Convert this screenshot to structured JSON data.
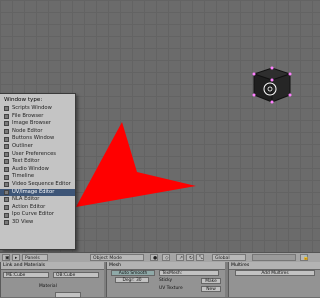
{
  "menu": {
    "title": "Window type:",
    "items": [
      {
        "label": "Scripts Window",
        "selected": false
      },
      {
        "label": "File Browser",
        "selected": false
      },
      {
        "label": "Image Browser",
        "selected": false
      },
      {
        "label": "Node Editor",
        "selected": false
      },
      {
        "label": "Buttons Window",
        "selected": false
      },
      {
        "label": "Outliner",
        "selected": false
      },
      {
        "label": "User Preferences",
        "selected": false
      },
      {
        "label": "Text Editor",
        "selected": false
      },
      {
        "label": "Audio Window",
        "selected": false
      },
      {
        "label": "Timeline",
        "selected": false
      },
      {
        "label": "Video Sequence Editor",
        "selected": false
      },
      {
        "label": "UV/Image Editor",
        "selected": true
      },
      {
        "label": "NLA Editor",
        "selected": false
      },
      {
        "label": "Action Editor",
        "selected": false
      },
      {
        "label": "Ipo Curve Editor",
        "selected": false
      },
      {
        "label": "3D View",
        "selected": false
      }
    ]
  },
  "header": {
    "panels_label": "Panels",
    "mode": "Object Mode",
    "orientation": "Global"
  },
  "panels": {
    "link_materials": {
      "title": "Link and Materials",
      "me_field": "ME:Cube",
      "ob_field": "OB:Cube",
      "material_label": "Material"
    },
    "mesh": {
      "title": "Mesh",
      "auto_smooth": "Auto Smooth",
      "degr": "Degr: 30",
      "texmesh": "TexMesh:",
      "sticky_label": "Sticky",
      "sticky_btn": "Make",
      "uvtexture_label": "UV Texture",
      "uvtexture_btn": "New"
    },
    "multires": {
      "title": "Multires",
      "add_btn": "Add Multires"
    }
  },
  "colors": {
    "viewport_bg": "#6b6b6b",
    "menu_bg": "#c4c4c4",
    "selection": "#3d5577",
    "arrow": "#ff0000"
  }
}
